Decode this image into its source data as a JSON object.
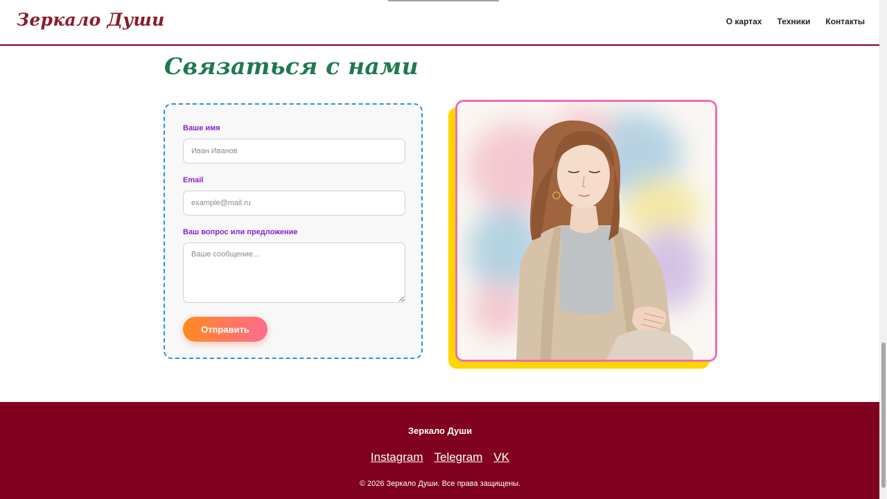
{
  "header": {
    "logo": "Зеркало Души",
    "nav": [
      {
        "label": "О картах"
      },
      {
        "label": "Техники"
      },
      {
        "label": "Контакты"
      }
    ]
  },
  "contact": {
    "title": "Связаться с нами",
    "form": {
      "name_label": "Ваше имя",
      "name_placeholder": "Иван Иванов",
      "email_label": "Email",
      "email_placeholder": "example@mail.ru",
      "message_label": "Ваш вопрос или предложение",
      "message_placeholder": "Ваше сообщение...",
      "submit_label": "Отправить"
    }
  },
  "footer": {
    "brand": "Зеркало Души",
    "links": [
      {
        "label": "Instagram"
      },
      {
        "label": "Telegram"
      },
      {
        "label": "VK"
      }
    ],
    "copyright": "© 2026 Зеркало Души. Все права защищены."
  },
  "colors": {
    "brand": "#800020",
    "title_green": "#1f7a4c",
    "label_purple": "#8a1fd1",
    "form_border": "#2a8fe0",
    "image_border": "#f06bb5",
    "image_shadow": "#ffd600",
    "button_gradient_start": "#ff8a1e",
    "button_gradient_end": "#ff6b8f"
  }
}
